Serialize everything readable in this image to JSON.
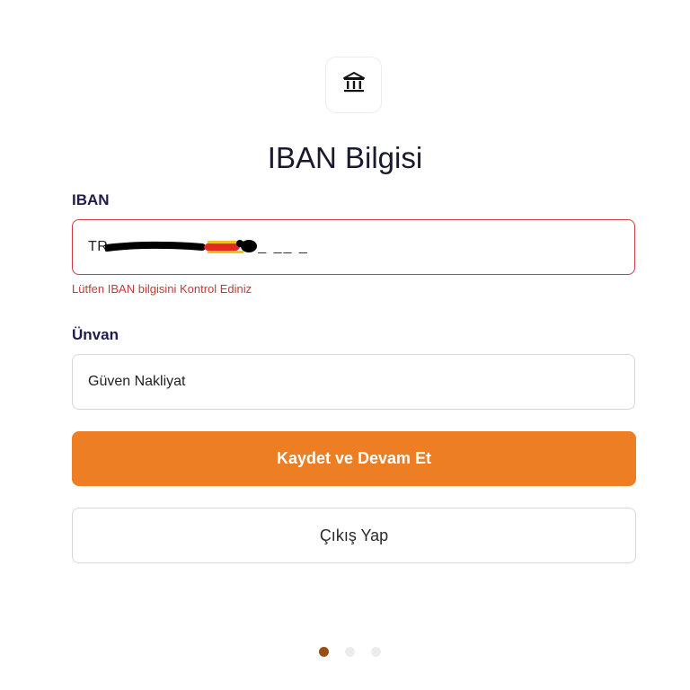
{
  "header": {
    "icon": "bank-icon",
    "title": "IBAN Bilgisi"
  },
  "form": {
    "iban": {
      "label": "IBAN",
      "prefix": "TR",
      "mask_tail": "_ __ _",
      "error": "Lütfen IBAN bilgisini Kontrol Ediniz",
      "border_color": "#cf3b45"
    },
    "unvan": {
      "label": "Ünvan",
      "value": "Güven Nakliyat"
    }
  },
  "actions": {
    "save_continue": "Kaydet ve Devam Et",
    "logout": "Çıkış Yap"
  },
  "pagination": {
    "total": 3,
    "current": 1
  },
  "colors": {
    "accent": "#ee7e23",
    "error": "#c33a3a",
    "active_dot": "#9a4e16"
  }
}
